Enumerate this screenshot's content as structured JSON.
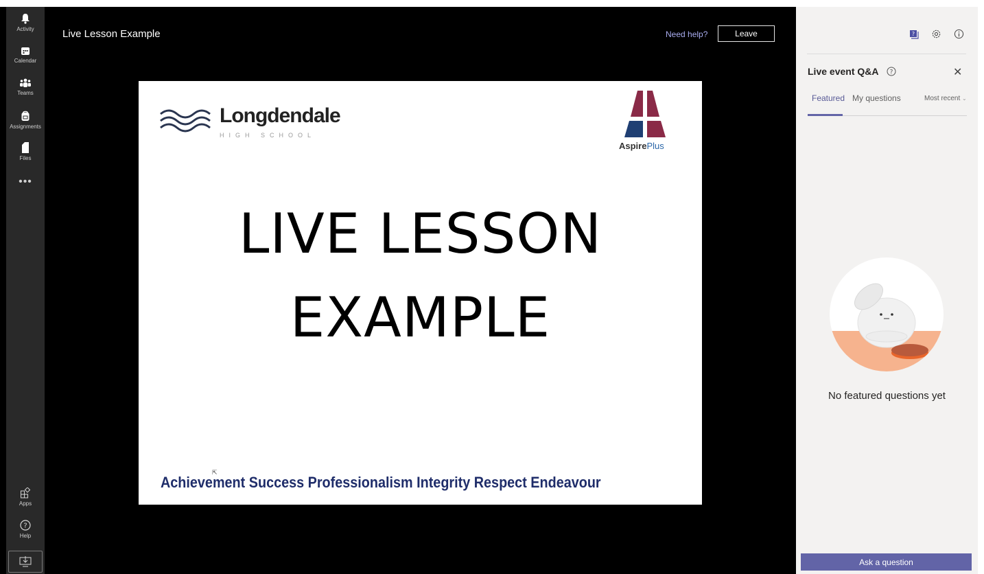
{
  "rail": {
    "items": [
      {
        "label": "Activity"
      },
      {
        "label": "Calendar"
      },
      {
        "label": "Teams"
      },
      {
        "label": "Assignments"
      },
      {
        "label": "Files"
      }
    ],
    "more": "•••",
    "bottom": [
      {
        "label": "Apps"
      },
      {
        "label": "Help"
      }
    ]
  },
  "stage": {
    "title": "Live Lesson Example",
    "need_help": "Need help?",
    "leave": "Leave"
  },
  "slide": {
    "school_name": "Longdendale",
    "school_sub": "HIGH SCHOOL",
    "trust_name_1": "Aspire",
    "trust_name_2": "Plus",
    "title_line1": "LIVE LESSON",
    "title_line2": "EXAMPLE",
    "values": [
      "Achievement",
      "Success",
      "Professionalism",
      "Integrity",
      "Respect",
      "Endeavour"
    ],
    "colors": {
      "maroon": "#8a2a47",
      "navy": "#1f3f73",
      "text_navy": "#1f2d6a"
    }
  },
  "panel": {
    "title": "Live event Q&A",
    "tabs": {
      "featured": "Featured",
      "my_questions": "My questions"
    },
    "sort": "Most recent",
    "empty_text": "No featured questions yet",
    "ask_button": "Ask a question",
    "accent": "#6264a7"
  }
}
